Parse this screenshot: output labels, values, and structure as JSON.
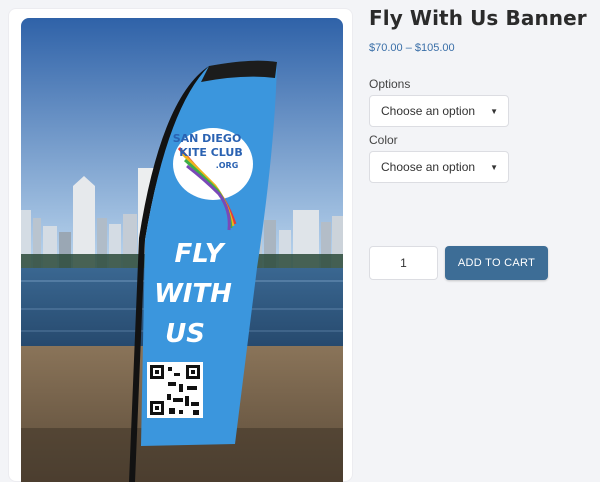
{
  "product": {
    "title": "Fly With Us Banner",
    "price": "$70.00 – $105.00",
    "image": {
      "flag_logo": [
        "SAN DIEGO",
        "KITE CLUB",
        ".ORG"
      ],
      "flag_text": [
        "FLY",
        "WITH",
        "US"
      ]
    }
  },
  "options": {
    "label": "Options",
    "selected": "Choose an option"
  },
  "color": {
    "label": "Color",
    "selected": "Choose an option"
  },
  "cart": {
    "quantity": "1",
    "add_label": "ADD TO CART"
  },
  "colors": {
    "accent": "#3d6d96",
    "price": "#3a6fa8",
    "flag": "#3b96dd"
  },
  "icons": {
    "select_chevron": "chevron-down-icon"
  }
}
